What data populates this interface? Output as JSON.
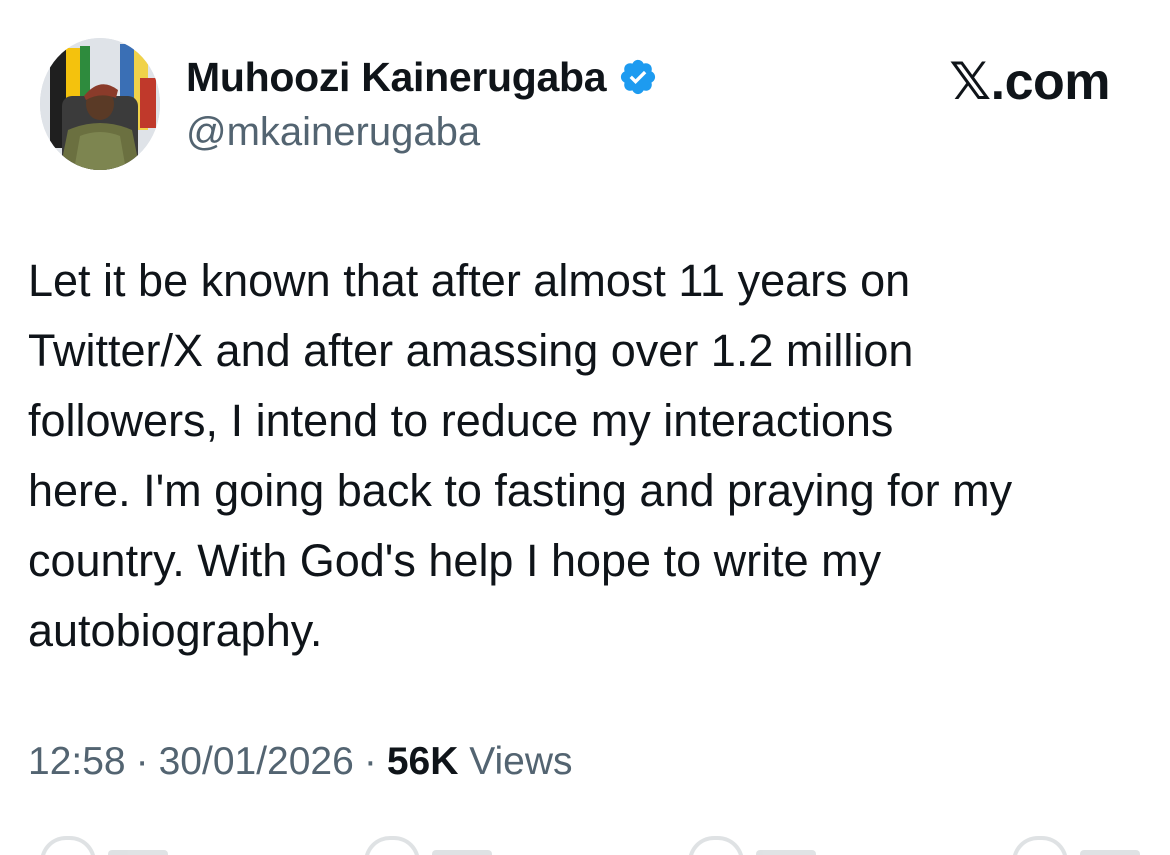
{
  "author": {
    "name": "Muhoozi Kainerugaba",
    "handle": "@mkainerugaba",
    "verified": true,
    "verified_color": "#1d9bf0",
    "avatar_icon": "profile-photo"
  },
  "brand": {
    "label": "𝕏.com"
  },
  "post": {
    "text": "Let it be known that after almost 11 years on\nTwitter/X and after amassing over 1.2 million\nfollowers, I intend to reduce my interactions\nhere. I'm going back to fasting and praying for my\ncountry. With God's help I hope to write my\nautobiography."
  },
  "meta": {
    "time": "12:58",
    "separator": "·",
    "date": "30/01/2026",
    "views_count": "56K",
    "views_label": "Views"
  },
  "actions": [
    {
      "name": "reply",
      "icon": "reply-icon"
    },
    {
      "name": "repost",
      "icon": "repost-icon"
    },
    {
      "name": "like",
      "icon": "heart-icon"
    },
    {
      "name": "bookmark",
      "icon": "bookmark-icon"
    }
  ],
  "colors": {
    "text": "#0f1419",
    "secondary": "#536471",
    "background": "#ffffff"
  }
}
